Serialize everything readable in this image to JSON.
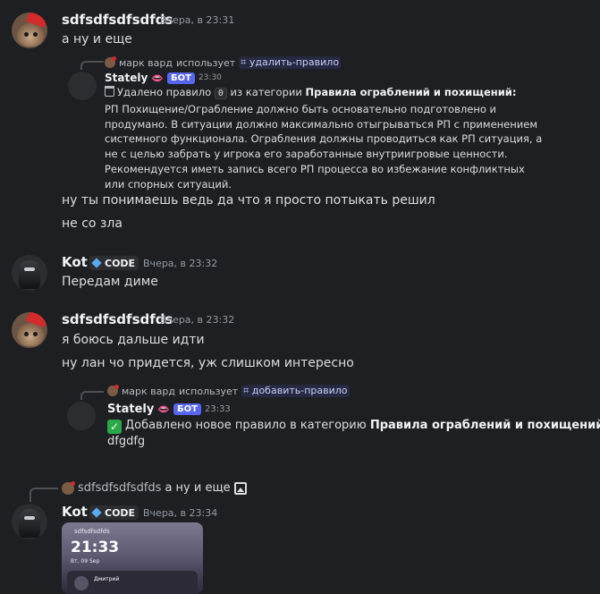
{
  "messages": {
    "m1": {
      "username": "sdfsdfsdfsdfds",
      "timestamp": "Вчера, в 23:31",
      "line1": "а ну и еще",
      "reply": {
        "user": "марк вард",
        "uses": "использует",
        "command": "⌗ удалить-правило"
      },
      "bot": {
        "name": "Stately",
        "badge": "БОТ",
        "time": "23:30"
      },
      "bot_text": {
        "pre": "Удалено правило",
        "code": "0",
        "mid": "из категории",
        "category": "Правила ограблений и похищений",
        "colon": ":",
        "body": "РП Похищение/Ограбление должно быть основательно подготовлено и продумано. В ситуации должно максимально отыгрываться РП с применением системного функционала. Ограбления должны проводиться как РП ситуация, а не с целью забрать у игрока его заработанные внутриигровые ценности. Рекомендуется иметь запись всего РП процесса во избежание конфликтных или спорных ситуаций."
      },
      "line2": "ну ты понимаешь ведь да что я просто потыкать решил",
      "line3": "не со зла"
    },
    "m2": {
      "username": "Kot",
      "badge": "CODE",
      "timestamp": "Вчера, в 23:32",
      "line1": "Передам диме"
    },
    "m3": {
      "username": "sdfsdfsdfsdfds",
      "timestamp": "Вчера, в 23:32",
      "line1": "я боюсь дальше идти",
      "line2": "ну лан чо придется, уж слишком интересно",
      "reply": {
        "user": "марк вард",
        "uses": "использует",
        "command": "⌗ добавить-правило"
      },
      "bot": {
        "name": "Stately",
        "badge": "БОТ",
        "time": "23:33"
      },
      "bot_text": {
        "pre": "Добавлено новое правило в категорию",
        "category": "Правила ограблений и похищений",
        "colon": ":",
        "body": "dfgdfg"
      }
    },
    "m4": {
      "reply_user": "sdfsdfsdfsdfds",
      "reply_text": "а ну и еще",
      "username": "Kot",
      "badge": "CODE",
      "timestamp": "Вчера, в 23:34",
      "attachment": {
        "time": "21:33",
        "date": "Вт, 09 Sep",
        "small": "sdfsdfsdfds",
        "card_name": "Дмитрий"
      }
    }
  },
  "colors": {
    "background": "#1e1f22",
    "bot_badge": "#5865f2",
    "username": "#f2f3f5",
    "timestamp": "#949ba4"
  }
}
